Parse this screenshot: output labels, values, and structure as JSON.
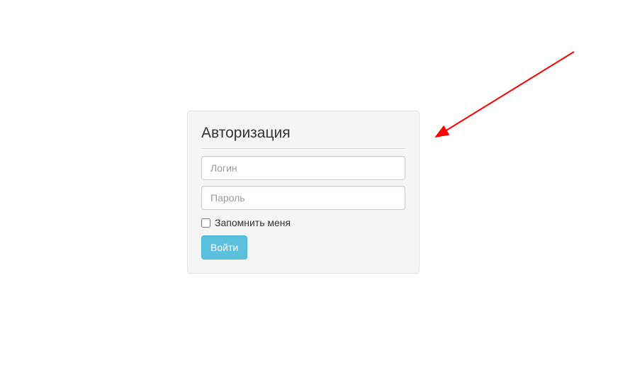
{
  "login": {
    "title": "Авторизация",
    "username_placeholder": "Логин",
    "password_placeholder": "Пароль",
    "remember_label": "Запомнить меня",
    "submit_label": "Войти"
  },
  "annotation": {
    "arrow_color": "#ff0000"
  }
}
